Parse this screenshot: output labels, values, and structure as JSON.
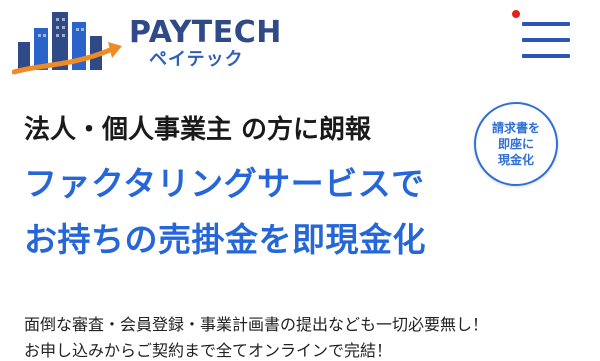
{
  "header": {
    "brand_en": "PAYTECH",
    "brand_ja": "ペイテック",
    "menu_icon": "hamburger-menu-icon",
    "notification_dot_color": "#e2231a"
  },
  "hero": {
    "subtitle": "法人・個人事業主 の方に朗報",
    "title_line1": "ファクタリングサービスで",
    "title_line2": "お持ちの売掛金を即現金化",
    "badge": "請求書を\n即座に\n現金化"
  },
  "body": {
    "line1": "面倒な審査・会員登録・事業計画書の提出なども一切必要無し！",
    "line2": "お申し込みからご契約まで全てオンラインで完結！"
  },
  "colors": {
    "brand_navy": "#2f4a86",
    "accent_blue": "#2566d8",
    "text_dark": "#1a1a1a"
  }
}
